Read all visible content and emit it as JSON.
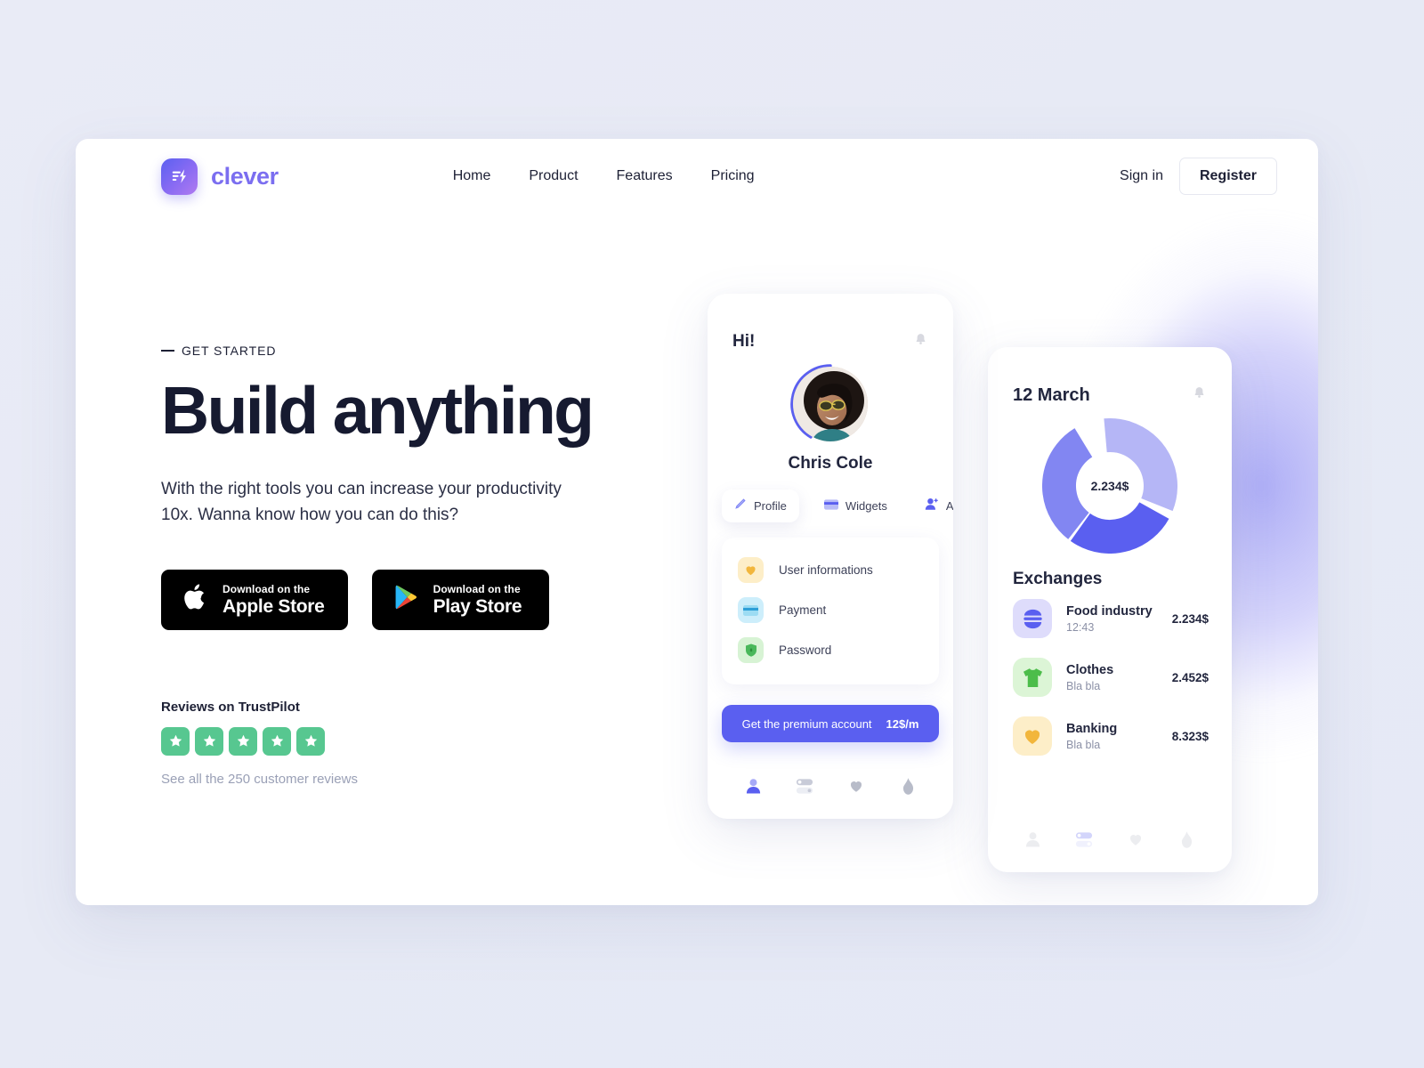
{
  "brand": {
    "name": "clever",
    "logo_icon": "lightning-bolt-icon",
    "accent": "#7b6ef0"
  },
  "nav": {
    "links": [
      {
        "label": "Home"
      },
      {
        "label": "Product"
      },
      {
        "label": "Features"
      },
      {
        "label": "Pricing"
      }
    ],
    "signin_label": "Sign in",
    "register_label": "Register"
  },
  "hero": {
    "eyebrow": "GET STARTED",
    "title": "Build anything",
    "subtitle": "With the right tools you can increase your productivity 10x. Wanna know how you can do this?",
    "stores": [
      {
        "icon": "apple-icon",
        "small": "Download on the",
        "big": "Apple Store"
      },
      {
        "icon": "google-play-icon",
        "small": "Download on the",
        "big": "Play Store"
      }
    ],
    "reviews": {
      "title": "Reviews on TrustPilot",
      "stars": 5,
      "star_color": "#57c790",
      "link": "See all the 250 customer reviews"
    }
  },
  "phone_profile": {
    "greeting": "Hi!",
    "bell_icon": "bell-icon",
    "user_name": "Chris Cole",
    "avatar_icon": "avatar",
    "ring_color": "#5a5ff0",
    "tabs": [
      {
        "label": "Profile",
        "icon": "pen-icon",
        "active": true
      },
      {
        "label": "Widgets",
        "icon": "card-icon",
        "active": false
      },
      {
        "label": "Add frie",
        "icon": "add-friend-icon",
        "active": false
      }
    ],
    "settings": [
      {
        "label": "User informations",
        "icon": "heart-icon",
        "bg": "#fdeec8",
        "fg": "#f2b63c"
      },
      {
        "label": "Payment",
        "icon": "credit-card-icon",
        "bg": "#cdeefb",
        "fg": "#39b3e3"
      },
      {
        "label": "Password",
        "icon": "shield-icon",
        "bg": "#d7f3d4",
        "fg": "#49b85a"
      }
    ],
    "premium": {
      "label": "Get the premium account",
      "price": "12$/m",
      "color": "#5a5ff0"
    },
    "bottom_nav": [
      {
        "icon": "person-icon",
        "active": true
      },
      {
        "icon": "toggles-icon",
        "active": false
      },
      {
        "icon": "heart-icon",
        "active": false
      },
      {
        "icon": "flame-icon",
        "active": false
      }
    ]
  },
  "phone_exchanges": {
    "date": "12 March",
    "bell_icon": "bell-icon",
    "total": "2.234$",
    "section_title": "Exchanges",
    "items": [
      {
        "name": "Food industry",
        "sub": "12:43",
        "amount": "2.234$",
        "icon": "burger-icon",
        "bg": "#dedcfb",
        "fg": "#5a5ff0"
      },
      {
        "name": "Clothes",
        "sub": "Bla bla",
        "amount": "2.452$",
        "icon": "tshirt-icon",
        "bg": "#dcf5d6",
        "fg": "#4cbd4a"
      },
      {
        "name": "Banking",
        "sub": "Bla bla",
        "amount": "8.323$",
        "icon": "heart-icon",
        "bg": "#fdeec8",
        "fg": "#f2b63c"
      }
    ],
    "bottom_nav": [
      {
        "icon": "person-icon",
        "active": false
      },
      {
        "icon": "toggles-icon",
        "active": true
      },
      {
        "icon": "heart-icon",
        "active": false
      },
      {
        "icon": "flame-icon",
        "active": false
      }
    ]
  },
  "chart_data": {
    "type": "pie",
    "title": "12 March",
    "center_label": "2.234$",
    "categories": [
      "Food industry",
      "Clothes",
      "Banking"
    ],
    "values": [
      2.234,
      2.452,
      8.323
    ],
    "colors": [
      "#b5b6f6",
      "#8286f2",
      "#5a5ff0"
    ],
    "donut": true,
    "legend": "none"
  }
}
